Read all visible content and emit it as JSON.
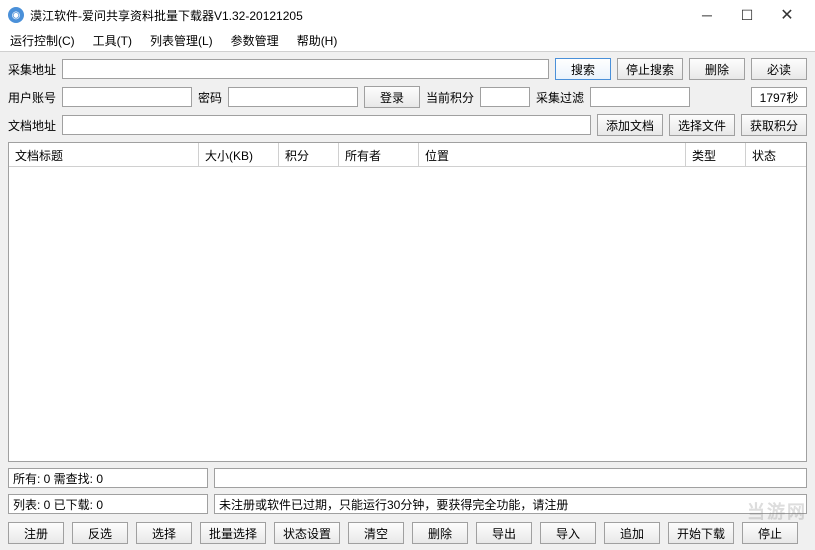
{
  "window": {
    "title": "漠江软件-爱问共享资料批量下载器V1.32-20121205"
  },
  "menu": {
    "run_control": "运行控制(C)",
    "tools": "工具(T)",
    "list_mgmt": "列表管理(L)",
    "param_mgmt": "参数管理",
    "help": "帮助(H)"
  },
  "row1": {
    "collect_url_label": "采集地址",
    "search_btn": "搜索",
    "stop_search_btn": "停止搜索",
    "delete_btn": "删除",
    "must_read_btn": "必读"
  },
  "row2": {
    "user_account_label": "用户账号",
    "password_label": "密码",
    "login_btn": "登录",
    "current_points_label": "当前积分",
    "collect_filter_label": "采集过滤",
    "timer": "1797秒"
  },
  "row3": {
    "doc_url_label": "文档地址",
    "add_doc_btn": "添加文档",
    "select_file_btn": "选择文件",
    "get_points_btn": "获取积分"
  },
  "table": {
    "headers": {
      "title": "文档标题",
      "size": "大小(KB)",
      "points": "积分",
      "owner": "所有者",
      "location": "位置",
      "type": "类型",
      "status": "状态"
    }
  },
  "status1": {
    "all_need_find": "所有: 0 需查找: 0"
  },
  "status2": {
    "list_downloaded": "列表: 0 已下载: 0",
    "register_msg": "未注册或软件已过期，只能运行30分钟，要获得完全功能，请注册"
  },
  "bottom": {
    "register": "注册",
    "invert": "反选",
    "select": "选择",
    "batch_select": "批量选择",
    "status_set": "状态设置",
    "clear": "清空",
    "delete": "删除",
    "export": "导出",
    "import": "导入",
    "append": "追加",
    "start_dl": "开始下载",
    "stop": "停止"
  },
  "watermark": "当游网"
}
